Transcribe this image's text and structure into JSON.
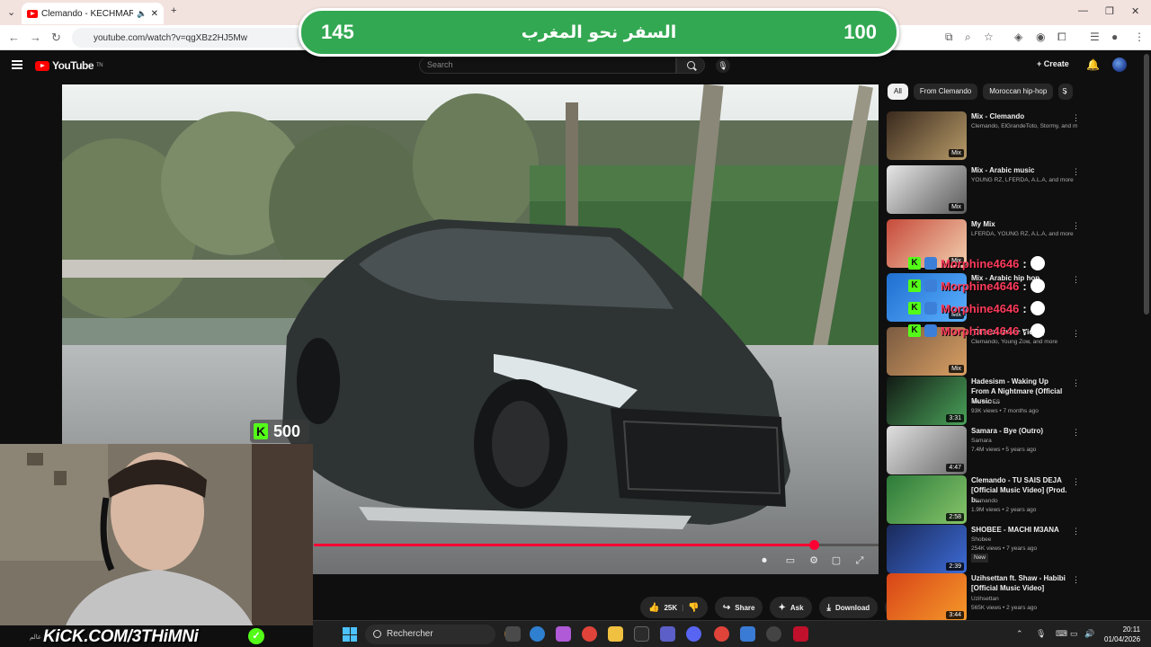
{
  "browser": {
    "tab_title": "Clemando - KECHMARRA (",
    "url": "youtube.com/watch?v=qgXBz2HJ5Mw"
  },
  "overlay": {
    "left_score": "145",
    "title": "السفر نحو المغرب",
    "right_score": "100",
    "kick_points": "500",
    "kick_url": "KiCK.COM/3THiMNi",
    "small_text": "عالم"
  },
  "youtube": {
    "logo_text": "YouTube",
    "logo_sup": "TN",
    "search_placeholder": "Search",
    "create_label": "Create"
  },
  "actions": {
    "likes": "25K",
    "share": "Share",
    "ask": "Ask",
    "download": "Download"
  },
  "chips": [
    "All",
    "From Clemando",
    "Moroccan hip-hop",
    "S"
  ],
  "recommendations": [
    {
      "title": "Mix - Clemando",
      "meta1": "Clemando, ElGrandeToto, Stormy, and m...",
      "meta2": "",
      "badge": "Mix"
    },
    {
      "title": "Mix - Arabic music",
      "meta1": "YOUNG RZ, LFERDA, A.L.A, and more",
      "meta2": "",
      "badge": "Mix"
    },
    {
      "title": "My Mix",
      "meta1": "LFERDA, YOUNG RZ, A.L.A, and more",
      "meta2": "",
      "badge": "Mix"
    },
    {
      "title": "Mix - Arabic hip hop",
      "meta1": "",
      "meta2": "",
      "badge": "Mix"
    },
    {
      "title": "[Official Music Video]",
      "meta1": "Clemando, Young Zow, and more",
      "meta2": "",
      "badge": "Mix"
    },
    {
      "title": "Hadesism - Waking Up From A Nightmare (Official Music ...",
      "meta1": "MARADES",
      "meta2": "93K views • 7 months ago",
      "badge": "3:31"
    },
    {
      "title": "Samara - Bye (Outro)",
      "meta1": "Samara",
      "meta2": "7.4M views • 5 years ago",
      "badge": "4:47"
    },
    {
      "title": "Clemando - TU SAIS DEJA [Official Music Video] (Prod. b...",
      "meta1": "Clemando",
      "meta2": "1.9M views • 2 years ago",
      "badge": "2:58"
    },
    {
      "title": "SHOBEE - MACHI M3ANA",
      "meta1": "Shobee",
      "meta2": "254K views • 7 years ago",
      "meta3": "New",
      "badge": "2:39"
    },
    {
      "title": "Uzihsettan ft. Shaw - Habibi [Official Music Video]",
      "meta1": "Uzihsettan",
      "meta2": "565K views • 2 years ago",
      "badge": "3:44"
    }
  ],
  "chat": [
    {
      "name": "Morphine4646",
      "colon": ":"
    },
    {
      "name": "Morphine4646",
      "colon": ":"
    },
    {
      "name": "Morphine4646",
      "colon": ":"
    },
    {
      "name": "Morphine4646",
      "colon": ":"
    }
  ],
  "taskbar": {
    "search": "Rechercher",
    "time": "20:11",
    "date": "01/04/2026"
  },
  "video_progress": 0.886,
  "colors": {
    "accent": "#ff0033",
    "kick": "#53fc18",
    "banner": "#33a852"
  }
}
